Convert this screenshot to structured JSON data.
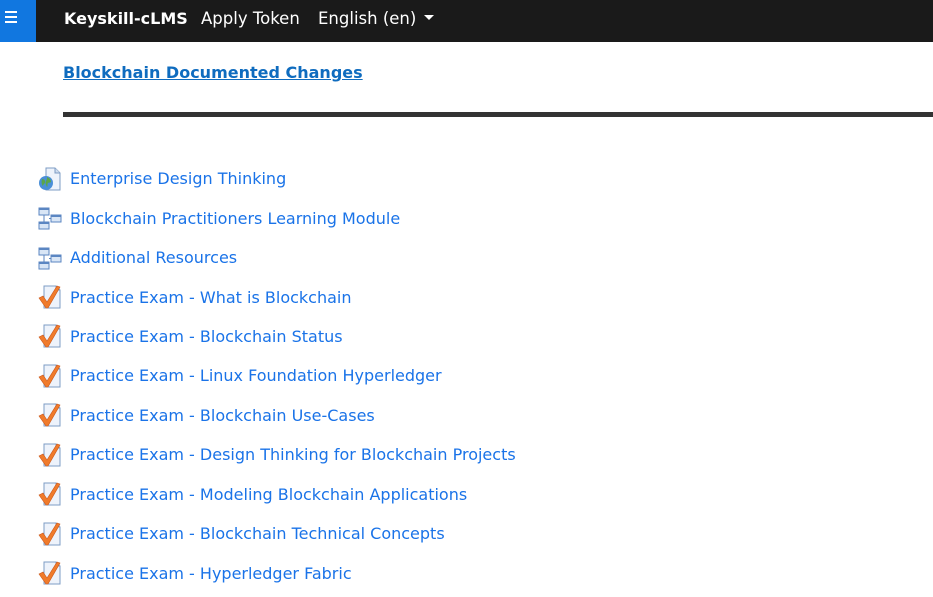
{
  "navbar": {
    "brand": "Keyskill-cLMS",
    "apply_token": "Apply Token",
    "language": "English (en)"
  },
  "section": {
    "title": "Blockchain Documented Changes"
  },
  "activities": [
    {
      "label": "Enterprise Design Thinking",
      "icon": "url-globe-icon"
    },
    {
      "label": "Blockchain Practitioners Learning Module",
      "icon": "scorm-package-icon"
    },
    {
      "label": "Additional Resources",
      "icon": "scorm-package-icon"
    },
    {
      "label": "Practice Exam - What is Blockchain",
      "icon": "quiz-checkmark-icon"
    },
    {
      "label": "Practice Exam - Blockchain Status",
      "icon": "quiz-checkmark-icon"
    },
    {
      "label": "Practice Exam - Linux Foundation Hyperledger",
      "icon": "quiz-checkmark-icon"
    },
    {
      "label": "Practice Exam - Blockchain Use-Cases",
      "icon": "quiz-checkmark-icon"
    },
    {
      "label": "Practice Exam - Design Thinking for Blockchain Projects",
      "icon": "quiz-checkmark-icon"
    },
    {
      "label": "Practice Exam - Modeling Blockchain Applications",
      "icon": "quiz-checkmark-icon"
    },
    {
      "label": "Practice Exam - Blockchain Technical Concepts",
      "icon": "quiz-checkmark-icon"
    },
    {
      "label": "Practice Exam - Hyperledger Fabric",
      "icon": "quiz-checkmark-icon"
    }
  ],
  "colors": {
    "navbar_bg": "#1a1a1a",
    "hamburger_bg": "#1177e0",
    "link": "#1a73e8"
  }
}
